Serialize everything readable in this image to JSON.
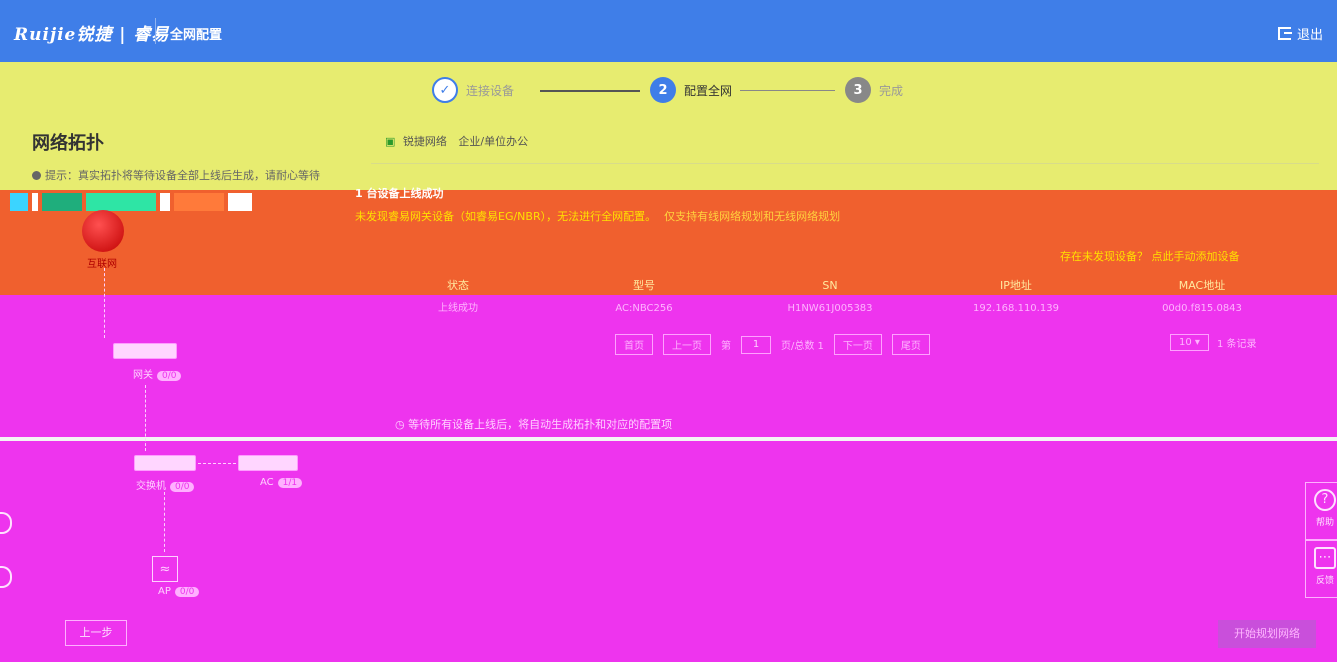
{
  "header": {
    "brand": "Ruijie锐捷 | 睿易",
    "title": "全网配置",
    "logout": "退出"
  },
  "steps": [
    {
      "num": "✓",
      "label": "连接设备"
    },
    {
      "num": "2",
      "label": "配置全网"
    },
    {
      "num": "3",
      "label": "完成"
    }
  ],
  "left": {
    "title": "网络拓扑",
    "tip": "提示：真实拓扑将等待设备全部上线后生成，请耐心等待",
    "internet": "互联网",
    "gateway": "网关",
    "gateway_count": "0/0",
    "switch": "交换机",
    "switch_count": "0/0",
    "ac": "AC",
    "ac_count": "1/1",
    "ap": "AP",
    "ap_count": "0/0",
    "prev": "上一步"
  },
  "right": {
    "network": "锐捷网络",
    "scene": "企业/单位办公",
    "status_head": "1 台设备上线成功",
    "warning": "未发现睿易网关设备（如睿易EG/NBR），无法进行全网配置。",
    "warning_tail": "仅支持有线网络规划和无线网络规划",
    "not_found": "存在未发现设备？ 点此手动添加设备",
    "table": {
      "headers": [
        "状态",
        "型号",
        "SN",
        "IP地址",
        "MAC地址"
      ],
      "rows": [
        [
          "上线成功",
          "AC:NBC256",
          "H1NW61J005383",
          "192.168.110.139",
          "00d0.f815.0843"
        ]
      ]
    },
    "pager": {
      "first": "首页",
      "prev": "上一页",
      "page_prefix": "第",
      "page": "1",
      "page_suffix": "页/总数 1",
      "next": "下一页",
      "last": "尾页",
      "page_size": "10",
      "records": "1 条记录"
    },
    "wait": "等待所有设备上线后，将自动生成拓扑和对应的配置项",
    "start": "开始规划网络"
  },
  "float": {
    "help": "帮助",
    "feedback": "反馈"
  }
}
